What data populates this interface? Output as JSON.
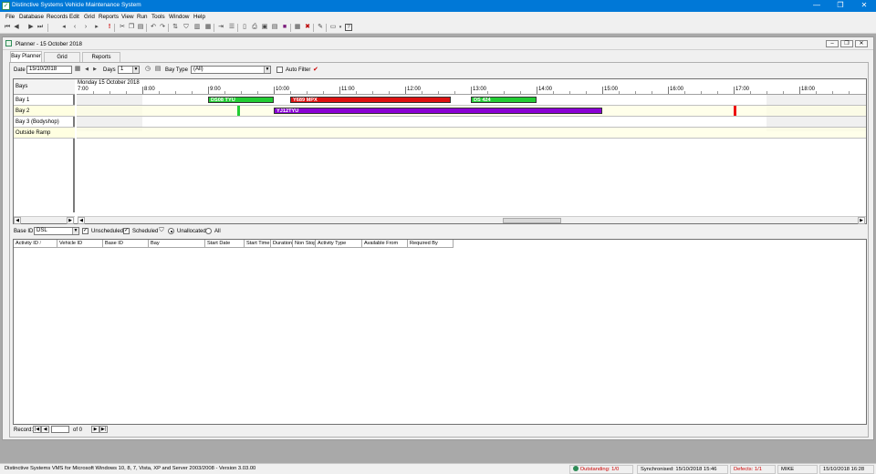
{
  "window": {
    "title": "Distinctive Systems Vehicle Maintenance System",
    "min_glyph": "—",
    "max_glyph": "❐",
    "close_glyph": "✕"
  },
  "menu": [
    "File",
    "Database",
    "Records",
    "Edit",
    "Grid",
    "Reports",
    "View",
    "Run",
    "Tools",
    "Window",
    "Help"
  ],
  "toolbar_icons": [
    "first-record-icon",
    "prev-record-icon",
    "next-record-icon",
    "last-record-icon",
    "save-icon",
    "cut-icon",
    "copy-icon",
    "paste-icon",
    "undo-icon",
    "redo-icon",
    "sort-icon",
    "filter-icon",
    "columns-icon",
    "print-icon",
    "preview-icon",
    "report-icon",
    "calendar-icon",
    "tools-icon",
    "window-icon",
    "help-icon"
  ],
  "child": {
    "title": "Planner - 15 October 2018",
    "tabs": [
      "Bay Planner",
      "Grid",
      "Reports"
    ]
  },
  "filters": {
    "date_label": "Date",
    "date_value": "15/10/2018",
    "days_label": "Days",
    "days_value": "1",
    "baytype_label": "Bay Type",
    "baytype_value": "(All)",
    "autofilter_label": "Auto Filter",
    "check_glyph": "✔"
  },
  "planner": {
    "bays_header": "Bays",
    "date_header": "Monday 15 October 2018",
    "hours": [
      "7:00",
      "8:00",
      "9:00",
      "10:00",
      "11:00",
      "12:00",
      "13:00",
      "14:00",
      "15:00",
      "16:00",
      "17:00",
      "18:00"
    ],
    "bays": [
      "Bay 1",
      "Bay 2",
      "Bay 3 (Bodyshop)",
      "Outside Ramp"
    ],
    "bookings": [
      {
        "label": "DS08 TYU",
        "bay": 0,
        "start_hour": 9.0,
        "end_hour": 10.0,
        "color": "#22cc33"
      },
      {
        "label": "Y689 MPX",
        "bay": 0,
        "start_hour": 10.25,
        "end_hour": 12.7,
        "color": "#dd1111"
      },
      {
        "label": "DS 424",
        "bay": 0,
        "start_hour": 13.0,
        "end_hour": 14.0,
        "color": "#22cc33"
      },
      {
        "label": "YJ12TYU",
        "bay": 1,
        "start_hour": 10.0,
        "end_hour": 15.0,
        "color": "#8a00d4"
      }
    ],
    "markers": [
      {
        "bay": 1,
        "hour": 9.45,
        "color": "#22cc33"
      },
      {
        "bay": 1,
        "hour": 17.0,
        "color": "#ee1111"
      }
    ]
  },
  "activity": {
    "base_id_label": "Base ID",
    "base_id_value": "DSL",
    "unscheduled_label": "Unscheduled",
    "scheduled_label": "Scheduled",
    "unallocated_label": "Unallocated",
    "all_label": "All",
    "columns": [
      "Activity ID",
      "Vehicle ID",
      "Base ID",
      "Bay",
      "Start Date",
      "Start Time",
      "Duration",
      "Non Stop",
      "Activity Type",
      "Available From",
      "Required By"
    ]
  },
  "record_nav": {
    "label": "Record:",
    "current": "",
    "of_label": "of 0"
  },
  "status": {
    "version": "Distinctive Systems VMS for Microsoft Windows 10, 8, 7, Vista, XP and Server 2003/2008 - Version 3.03.00",
    "outstanding": "Outstanding: 1/0",
    "synchronised": "Synchronised: 15/10/2018 15:46",
    "defects": "Defects: 1/1",
    "user": "MIKE",
    "datetime": "15/10/2018 16:28",
    "outstanding_color": "#cc0000",
    "defects_color": "#cc0000"
  }
}
